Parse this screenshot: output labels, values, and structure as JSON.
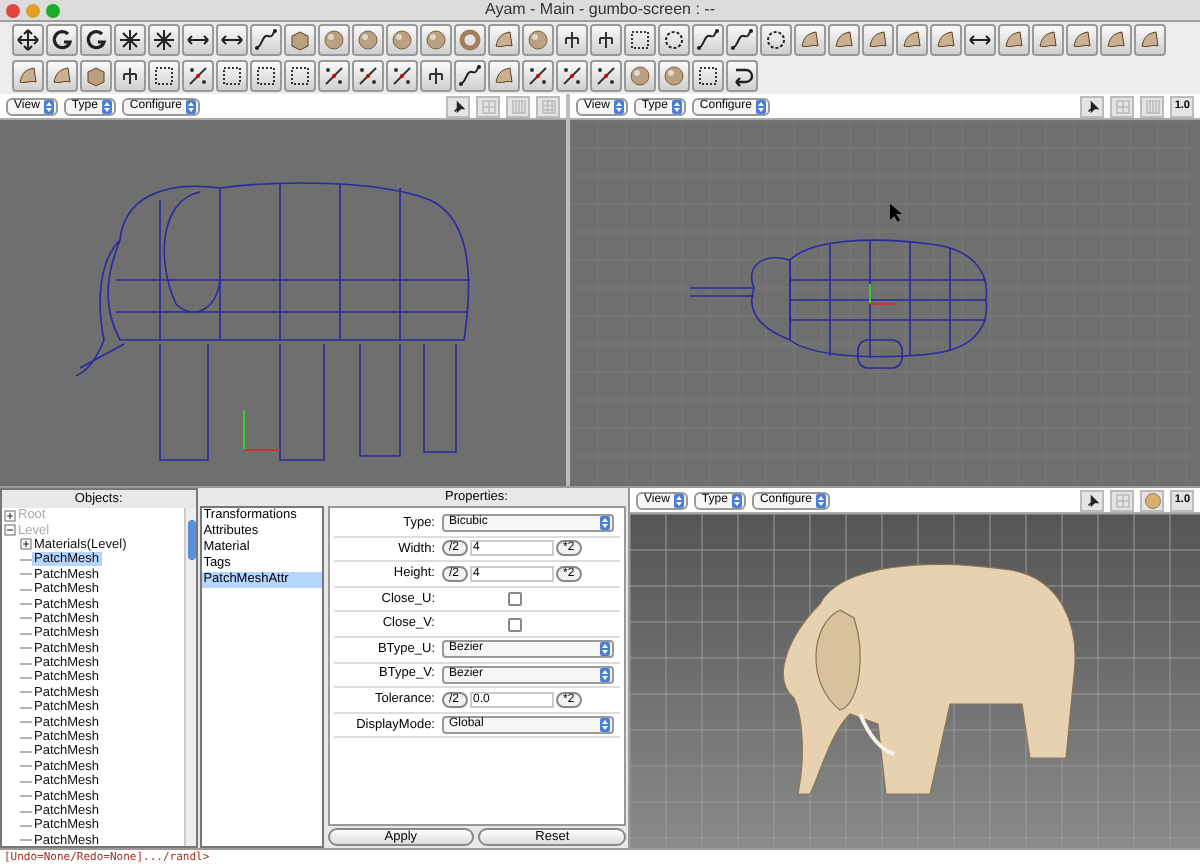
{
  "window": {
    "title": "Ayam - Main - gumbo-screen : --"
  },
  "viewports": [
    {
      "kind": "wire-front",
      "menus": [
        "View",
        "Type",
        "Configure"
      ]
    },
    {
      "kind": "wire-top",
      "menus": [
        "View",
        "Type",
        "Configure"
      ],
      "zoom_label": "1.0"
    },
    {
      "kind": "shaded",
      "menus": [
        "View",
        "Type",
        "Configure"
      ],
      "zoom_label": "1.0"
    }
  ],
  "objects": {
    "title": "Objects:",
    "tree": [
      {
        "label": "Root",
        "disabled": true,
        "expanded": false,
        "selected": false
      },
      {
        "label": "Level",
        "disabled": true,
        "expanded": true,
        "selected": false,
        "children": [
          {
            "label": "Materials(Level)",
            "expanded": false,
            "selected": false
          },
          {
            "label": "PatchMesh",
            "selected": true
          },
          {
            "label": "PatchMesh",
            "selected": false
          },
          {
            "label": "PatchMesh",
            "selected": false
          },
          {
            "label": "PatchMesh",
            "selected": false
          },
          {
            "label": "PatchMesh",
            "selected": false
          },
          {
            "label": "PatchMesh",
            "selected": false
          },
          {
            "label": "PatchMesh",
            "selected": false
          },
          {
            "label": "PatchMesh",
            "selected": false
          },
          {
            "label": "PatchMesh",
            "selected": false
          },
          {
            "label": "PatchMesh",
            "selected": false
          },
          {
            "label": "PatchMesh",
            "selected": false
          },
          {
            "label": "PatchMesh",
            "selected": false
          },
          {
            "label": "PatchMesh",
            "selected": false
          },
          {
            "label": "PatchMesh",
            "selected": false
          },
          {
            "label": "PatchMesh",
            "selected": false
          },
          {
            "label": "PatchMesh",
            "selected": false
          },
          {
            "label": "PatchMesh",
            "selected": false
          },
          {
            "label": "PatchMesh",
            "selected": false
          },
          {
            "label": "PatchMesh",
            "selected": false
          },
          {
            "label": "PatchMesh",
            "selected": false
          }
        ]
      }
    ]
  },
  "property_list": [
    {
      "label": "Transformations",
      "selected": false
    },
    {
      "label": "Attributes",
      "selected": false
    },
    {
      "label": "Material",
      "selected": false
    },
    {
      "label": "Tags",
      "selected": false
    },
    {
      "label": "PatchMeshAttr",
      "selected": true
    }
  ],
  "properties": {
    "title": "Properties:",
    "rows": [
      {
        "kind": "select",
        "label": "Type:",
        "value": "Bicubic"
      },
      {
        "kind": "spinner",
        "label": "Width:",
        "value": "4",
        "dec": "/2",
        "inc": "*2"
      },
      {
        "kind": "spinner",
        "label": "Height:",
        "value": "4",
        "dec": "/2",
        "inc": "*2"
      },
      {
        "kind": "checkbox",
        "label": "Close_U:",
        "checked": false
      },
      {
        "kind": "checkbox",
        "label": "Close_V:",
        "checked": false
      },
      {
        "kind": "select",
        "label": "BType_U:",
        "value": "Bezier"
      },
      {
        "kind": "select",
        "label": "BType_V:",
        "value": "Bezier"
      },
      {
        "kind": "spinner",
        "label": "Tolerance:",
        "value": "0.0",
        "dec": "/2",
        "inc": "*2"
      },
      {
        "kind": "select",
        "label": "DisplayMode:",
        "value": "Global"
      }
    ],
    "buttons": [
      "Apply",
      "Reset"
    ]
  },
  "console": {
    "prompt": "[Undo=None/Redo=None].../randl>"
  }
}
